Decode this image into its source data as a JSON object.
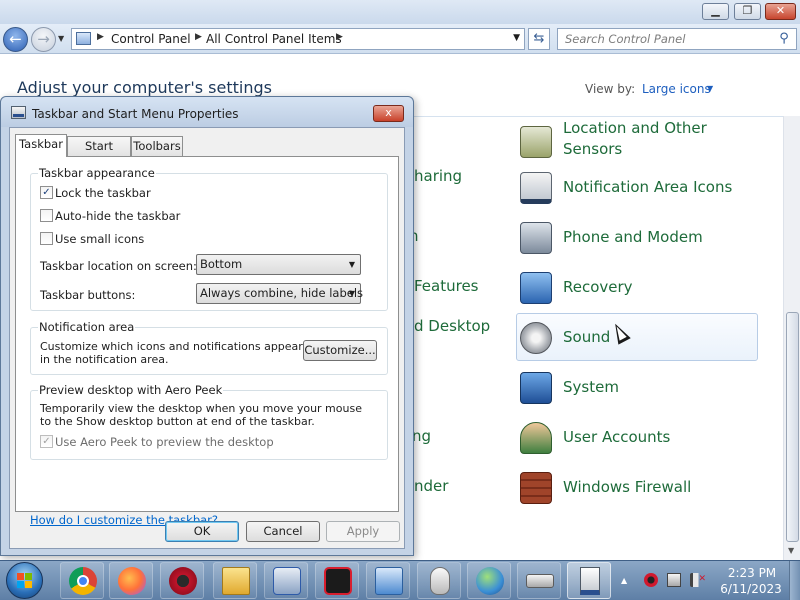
{
  "control_panel": {
    "breadcrumb": [
      "Control Panel",
      "All Control Panel Items"
    ],
    "search_placeholder": "Search Control Panel",
    "heading": "Adjust your computer's settings",
    "view_by_label": "View by:",
    "view_by_value": "Large icons",
    "partial_items": [
      "haring",
      "n",
      "Features",
      "d Desktop",
      "ng",
      "nder"
    ],
    "items": [
      {
        "label": "Location and Other Sensors",
        "icon": "location-sensor-icon"
      },
      {
        "label": "Notification Area Icons",
        "icon": "notification-area-icon"
      },
      {
        "label": "Phone and Modem",
        "icon": "phone-modem-icon"
      },
      {
        "label": "Recovery",
        "icon": "recovery-icon"
      },
      {
        "label": "Sound",
        "icon": "speaker-icon",
        "hovered": true
      },
      {
        "label": "System",
        "icon": "system-icon"
      },
      {
        "label": "User Accounts",
        "icon": "user-accounts-icon"
      },
      {
        "label": "Windows Firewall",
        "icon": "firewall-icon"
      }
    ]
  },
  "dialog": {
    "title": "Taskbar and Start Menu Properties",
    "close_label": "x",
    "tabs": [
      "Taskbar",
      "Start Menu",
      "Toolbars"
    ],
    "active_tab": "Taskbar",
    "taskbar_appearance": {
      "title": "Taskbar appearance",
      "lock_taskbar": {
        "label": "Lock the taskbar",
        "checked": true
      },
      "auto_hide": {
        "label": "Auto-hide the taskbar",
        "checked": false
      },
      "small_icons": {
        "label": "Use small icons",
        "checked": false
      },
      "location_label": "Taskbar location on screen:",
      "location_value": "Bottom",
      "buttons_label": "Taskbar buttons:",
      "buttons_value": "Always combine, hide labels"
    },
    "notification_area": {
      "title": "Notification area",
      "text": "Customize which icons and notifications appear in the notification area.",
      "button": "Customize..."
    },
    "aero_peek": {
      "title": "Preview desktop with Aero Peek",
      "text": "Temporarily view the desktop when you move your mouse to the Show desktop button at end of the taskbar.",
      "checkbox": {
        "label": "Use Aero Peek to preview the desktop",
        "checked": true,
        "disabled": true
      }
    },
    "help_link": "How do I customize the taskbar?",
    "buttons": {
      "ok": "OK",
      "cancel": "Cancel",
      "apply": "Apply"
    }
  },
  "taskbar": {
    "apps": [
      {
        "name": "chrome-icon",
        "color": "#db4437"
      },
      {
        "name": "firefox-icon",
        "color": "#ff7139"
      },
      {
        "name": "red-app-icon",
        "color": "#c0142a"
      },
      {
        "name": "file-explorer-icon",
        "color": "#f0c84a"
      },
      {
        "name": "remote-app-icon",
        "color": "#2e5aa8"
      },
      {
        "name": "screen-recorder-icon",
        "color": "#d81e2e"
      },
      {
        "name": "control-panel-icon",
        "color": "#4d8ad0"
      },
      {
        "name": "mouse-icon",
        "color": "#d8d8d8"
      },
      {
        "name": "network-globe-icon",
        "color": "#3b8fd6"
      },
      {
        "name": "keyboard-icon",
        "color": "#c9c9c9"
      },
      {
        "name": "taskbar-properties-icon",
        "color": "#e9e9e9",
        "active": true
      }
    ],
    "clock_time": "2:23 PM",
    "clock_date": "6/11/2023"
  },
  "colors": {
    "link": "#0066cc",
    "cp_item_text": "#1e6b3a",
    "accent": "#2c5fb3"
  }
}
